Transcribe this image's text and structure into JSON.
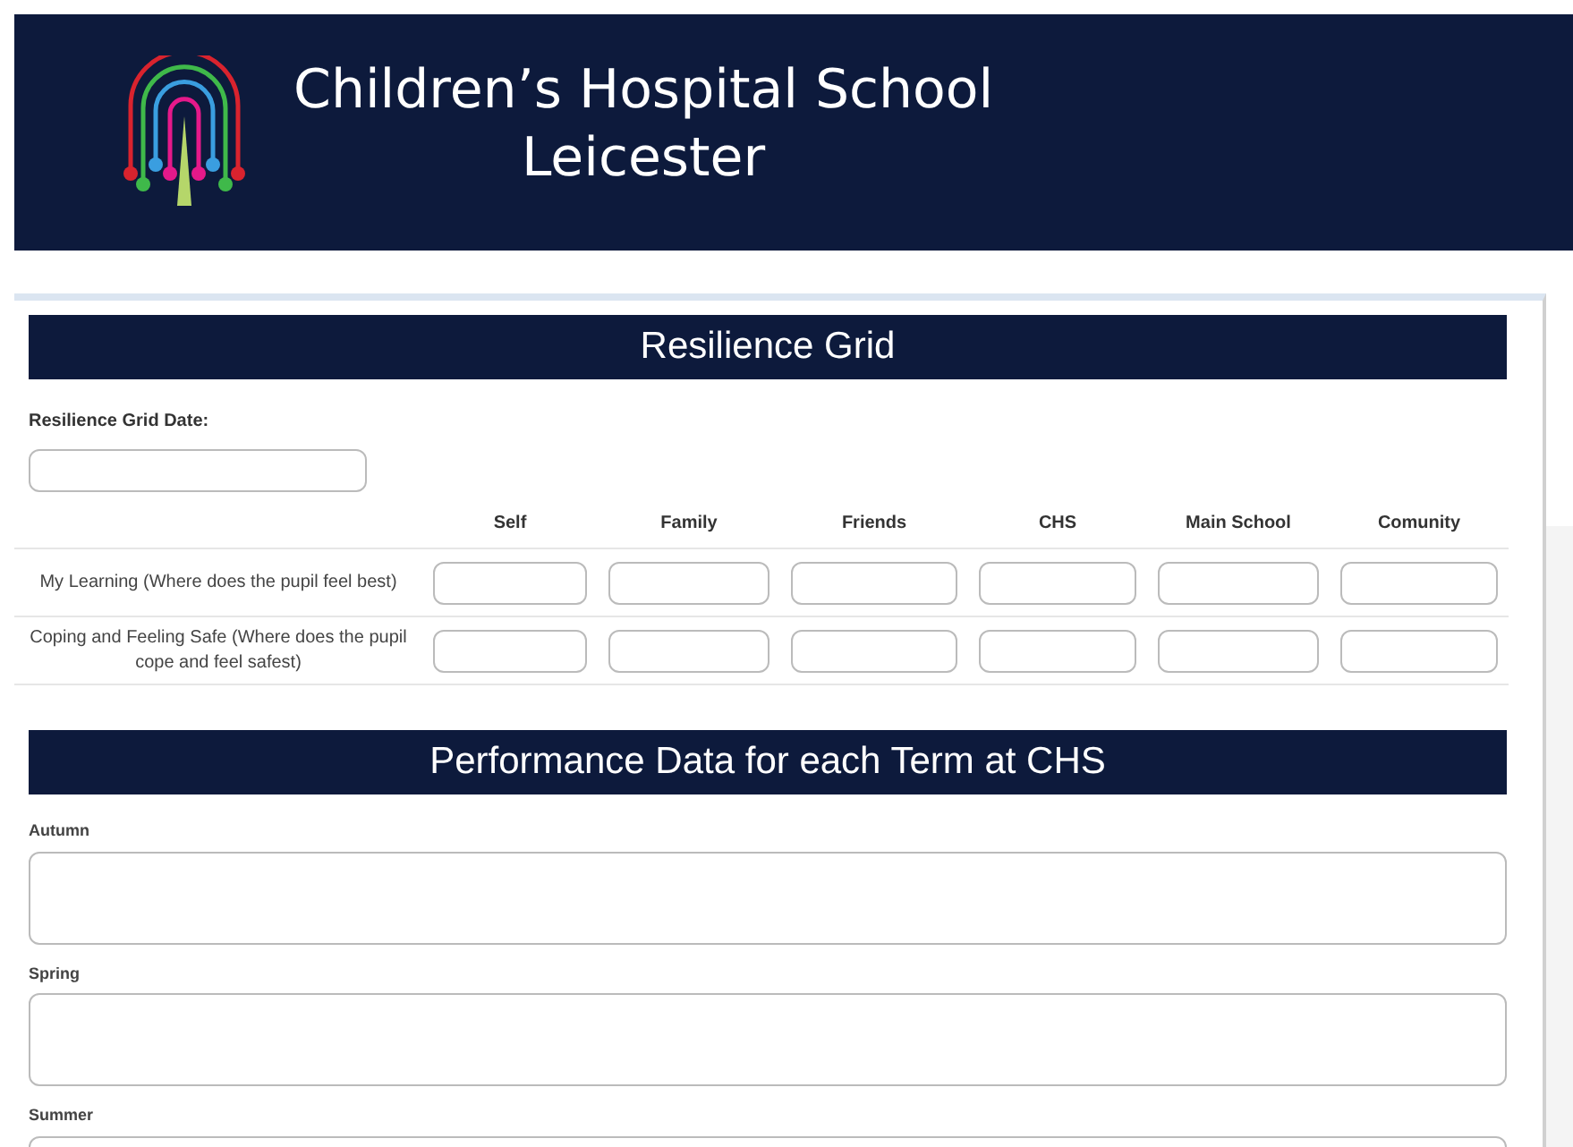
{
  "header": {
    "title_line_1": "Children’s Hospital School",
    "title_line_2": "Leicester"
  },
  "resilience": {
    "heading": "Resilience Grid",
    "date_label": "Resilience Grid Date:",
    "columns": [
      "Self",
      "Family",
      "Friends",
      "CHS",
      "Main School",
      "Comunity"
    ],
    "rows": [
      {
        "label": "My Learning (Where does the pupil feel best)"
      },
      {
        "label": "Coping and Feeling Safe (Where does the pupil cope and feel safest)"
      }
    ]
  },
  "performance": {
    "heading": "Performance Data for each Term at CHS",
    "terms": [
      {
        "label": "Autumn"
      },
      {
        "label": "Spring"
      },
      {
        "label": "Summer"
      }
    ]
  }
}
